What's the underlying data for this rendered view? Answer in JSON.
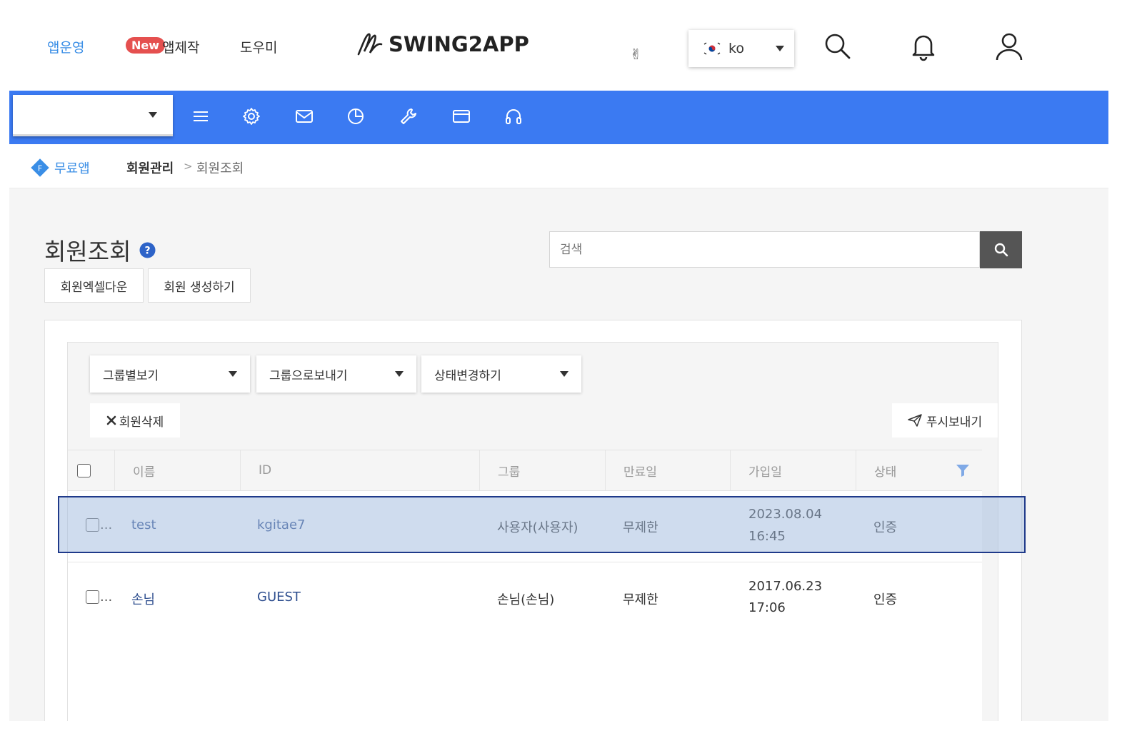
{
  "topnav": {
    "app_run": "앱운영",
    "new_badge": "New",
    "app_make": "앱제작",
    "helper": "도우미",
    "logo_text": "SWING2APP",
    "hand_glyph": "✌",
    "lang": "ko",
    "icons": [
      "search-icon",
      "bell-icon",
      "user-icon"
    ]
  },
  "toolbar": {
    "app_select_value": "",
    "icons": [
      "menu-icon",
      "gear-icon",
      "mail-icon",
      "pie-chart-icon",
      "wrench-icon",
      "card-icon",
      "headset-icon"
    ],
    "color": "#3b7af2"
  },
  "breadcrumb": {
    "free": "무료앱",
    "level1": "회원관리",
    "separator": ">",
    "level2": "회원조회"
  },
  "page": {
    "title": "회원조회",
    "excel_button": "회원엑셀다운",
    "create_button": "회원 생성하기",
    "search_placeholder": "검색"
  },
  "filters": {
    "group_view": "그룹별보기",
    "group_send": "그룹으로보내기",
    "status_change": "상태변경하기",
    "delete_button": "회원삭제",
    "push_button": "푸시보내기"
  },
  "table": {
    "headers": [
      "이름",
      "ID",
      "그룹",
      "만료일",
      "가입일",
      "상태"
    ],
    "rows": [
      {
        "ellipsis": "...",
        "name": "test",
        "id": "kgitae7",
        "group": "사용자(사용자)",
        "expire": "무제한",
        "joined_date": "2023.08.04",
        "joined_time": "16:45",
        "status": "인증"
      },
      {
        "ellipsis": "...",
        "name": "손님",
        "id": "GUEST",
        "group": "손님(손님)",
        "expire": "무제한",
        "joined_date": "2017.06.23",
        "joined_time": "17:06",
        "status": "인증"
      }
    ]
  }
}
